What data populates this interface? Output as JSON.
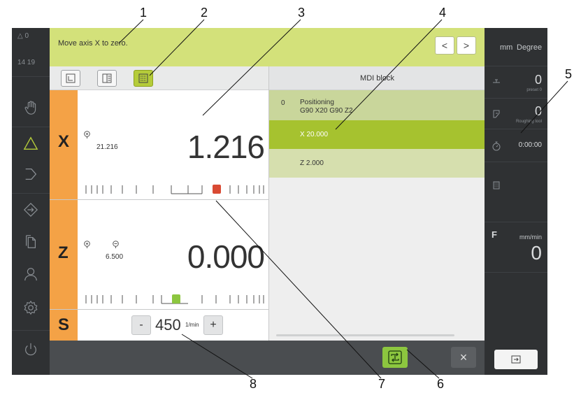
{
  "callouts": [
    "1",
    "2",
    "3",
    "4",
    "5",
    "6",
    "7",
    "8"
  ],
  "nav": {
    "warnings": "△ 0",
    "time": "14 19",
    "items": [
      "manual-mode",
      "mdi-mode",
      "program-run",
      "setup",
      "file-management",
      "user-login",
      "settings",
      "power"
    ]
  },
  "message": {
    "text": "Move axis X to zero.",
    "prev": "<",
    "next": ">"
  },
  "axes": {
    "x": {
      "letter": "X",
      "ref": "21.216",
      "value": "1.216",
      "marker_color": "#d94a33"
    },
    "z": {
      "letter": "Z",
      "ref": "6.500",
      "value": "0.000",
      "marker_color": "#8cc63f"
    },
    "s": {
      "letter": "S",
      "minus": "-",
      "value": "450",
      "unit": "1/min",
      "plus": "+"
    }
  },
  "mdi": {
    "title": "MDI block",
    "blocks": [
      {
        "num": "0",
        "line1": "Positioning",
        "line2": "G90 X20 G90 Z2"
      },
      {
        "num": "",
        "line1": "X 20.000",
        "line2": ""
      },
      {
        "num": "",
        "line1": "Z 2.000",
        "line2": ""
      }
    ]
  },
  "status": {
    "unit_length": "mm",
    "unit_angle": "Degree",
    "preset_value": "0",
    "preset_label": "preset 0",
    "tool_value": "0",
    "tool_label": "Roughing tool",
    "timer": "0:00:00",
    "feed_letter": "F",
    "feed_unit": "mm/min",
    "feed_value": "0"
  },
  "colors": {
    "accent_green": "#b5cc3a",
    "message_bar": "#d3e17a",
    "axis_tab": "#f4a246",
    "nav_active": "#b5cc3a"
  },
  "icons": {
    "close": "×"
  }
}
